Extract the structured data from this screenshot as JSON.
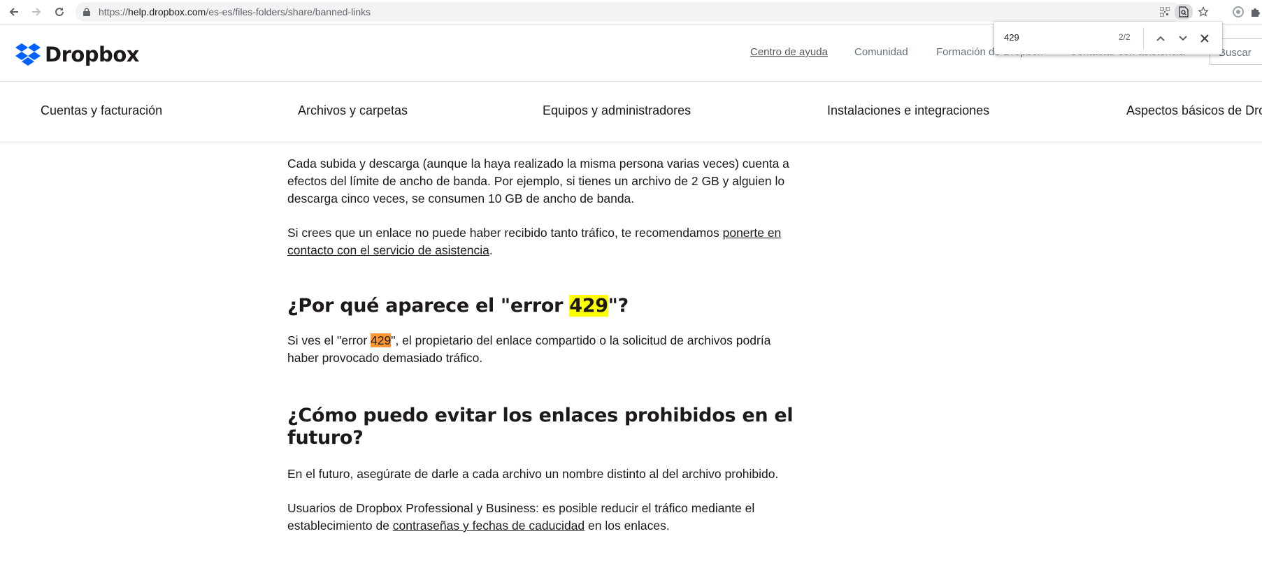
{
  "browser": {
    "url_prefix": "https://",
    "url_host": "help.dropbox.com",
    "url_path": "/es-es/files-folders/share/banned-links"
  },
  "findbar": {
    "query": "429",
    "count": "2/2"
  },
  "header": {
    "logo_text": "Dropbox",
    "links": [
      "Centro de ayuda",
      "Comunidad",
      "Formación de Dropbox",
      "Contactar con asistencia"
    ],
    "search_label": "Buscar"
  },
  "categories": [
    "Cuentas y facturación",
    "Archivos y carpetas",
    "Equipos y administradores",
    "Instalaciones e integraciones",
    "Aspectos básicos de Dropbox"
  ],
  "article": {
    "p1": "Cada subida y descarga (aunque la haya realizado la misma persona varias veces) cuenta a efectos del límite de ancho de banda. Por ejemplo, si tienes un archivo de 2 GB y alguien lo descarga cinco veces, se consumen 10 GB de ancho de banda.",
    "p2_text": "Si crees que un enlace no puede haber recibido tanto tráfico, te recomendamos ",
    "p2_link": "ponerte en contacto con el servicio de asistencia",
    "p2_end": ".",
    "h1_before": "¿Por qué aparece el \"error ",
    "h1_highlight": "429",
    "h1_after": "\"?",
    "p3_before": "Si ves el \"error ",
    "p3_highlight": "429",
    "p3_after": "\", el propietario del enlace compartido o la solicitud de archivos podría haber provocado demasiado tráfico.",
    "h2": "¿Cómo puedo evitar los enlaces prohibidos en el futuro?",
    "p4": "En el futuro, asegúrate de darle a cada archivo un nombre distinto al del archivo prohibido.",
    "p5_text": "Usuarios de Dropbox Professional y Business: es posible reducir el tráfico mediante el establecimiento de ",
    "p5_link": "contraseñas y fechas de caducidad",
    "p5_end": " en los enlaces."
  },
  "colors": {
    "brand_blue": "#0061ff",
    "find_active": "#ff9632",
    "find_match": "#ffff00"
  }
}
